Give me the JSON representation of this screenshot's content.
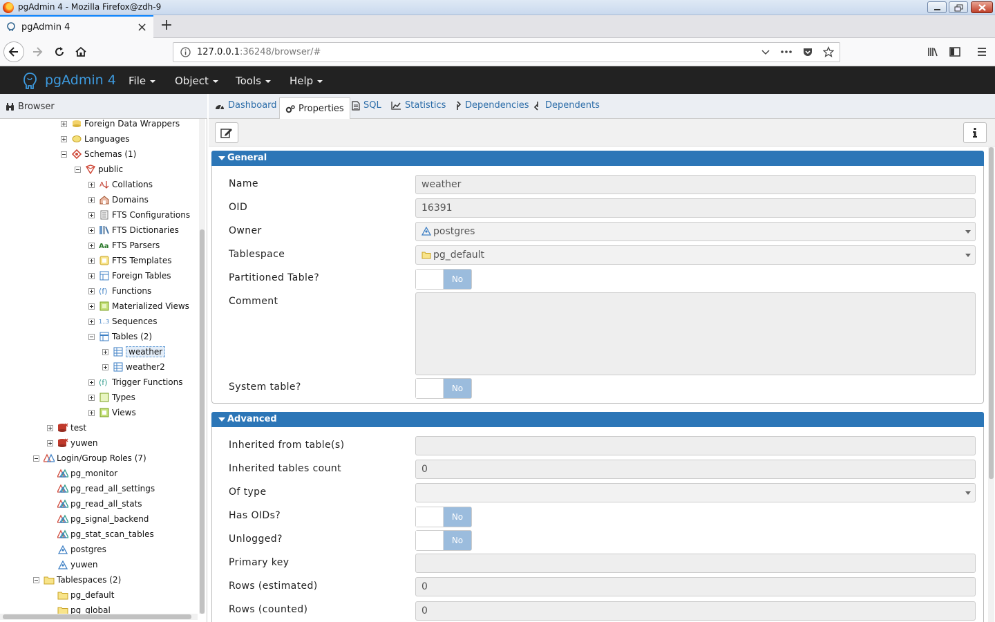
{
  "window": {
    "title": "pgAdmin 4 - Mozilla Firefox@zdh-9"
  },
  "browser_tab": {
    "label": "pgAdmin 4",
    "close": "×",
    "new_tab": "+"
  },
  "address": {
    "host": "127.0.0.1",
    "rest": ":36248/browser/#"
  },
  "app": {
    "brand": "pgAdmin 4",
    "menus": [
      "File",
      "Object",
      "Tools",
      "Help"
    ]
  },
  "browser_panel": {
    "title": "Browser",
    "tree": [
      {
        "label": "Foreign Data Wrappers",
        "depth": 4,
        "expander": "plus",
        "icon": "fdw-icon"
      },
      {
        "label": "Languages",
        "depth": 4,
        "expander": "plus",
        "icon": "language-icon"
      },
      {
        "label": "Schemas (1)",
        "depth": 4,
        "expander": "minus",
        "icon": "schemas-icon"
      },
      {
        "label": "public",
        "depth": 5,
        "expander": "minus",
        "icon": "schema-icon"
      },
      {
        "label": "Collations",
        "depth": 6,
        "expander": "plus",
        "icon": "collation-icon"
      },
      {
        "label": "Domains",
        "depth": 6,
        "expander": "plus",
        "icon": "domain-icon"
      },
      {
        "label": "FTS Configurations",
        "depth": 6,
        "expander": "plus",
        "icon": "fts-config-icon"
      },
      {
        "label": "FTS Dictionaries",
        "depth": 6,
        "expander": "plus",
        "icon": "fts-dict-icon"
      },
      {
        "label": "FTS Parsers",
        "depth": 6,
        "expander": "plus",
        "icon": "fts-parser-icon"
      },
      {
        "label": "FTS Templates",
        "depth": 6,
        "expander": "plus",
        "icon": "fts-template-icon"
      },
      {
        "label": "Foreign Tables",
        "depth": 6,
        "expander": "plus",
        "icon": "foreign-table-icon"
      },
      {
        "label": "Functions",
        "depth": 6,
        "expander": "plus",
        "icon": "function-icon"
      },
      {
        "label": "Materialized Views",
        "depth": 6,
        "expander": "plus",
        "icon": "mview-icon"
      },
      {
        "label": "Sequences",
        "depth": 6,
        "expander": "plus",
        "icon": "sequence-icon"
      },
      {
        "label": "Tables (2)",
        "depth": 6,
        "expander": "minus",
        "icon": "tables-icon"
      },
      {
        "label": "weather",
        "depth": 7,
        "expander": "plus",
        "icon": "table-icon",
        "selected": true
      },
      {
        "label": "weather2",
        "depth": 7,
        "expander": "plus",
        "icon": "table-icon"
      },
      {
        "label": "Trigger Functions",
        "depth": 6,
        "expander": "plus",
        "icon": "trigger-function-icon"
      },
      {
        "label": "Types",
        "depth": 6,
        "expander": "plus",
        "icon": "type-icon"
      },
      {
        "label": "Views",
        "depth": 6,
        "expander": "plus",
        "icon": "view-icon"
      },
      {
        "label": "test",
        "depth": 3,
        "expander": "plus",
        "icon": "database-icon"
      },
      {
        "label": "yuwen",
        "depth": 3,
        "expander": "plus",
        "icon": "database-icon"
      },
      {
        "label": "Login/Group Roles (7)",
        "depth": 2,
        "expander": "minus",
        "icon": "roles-icon"
      },
      {
        "label": "pg_monitor",
        "depth": 3,
        "expander": "",
        "icon": "group-role-icon"
      },
      {
        "label": "pg_read_all_settings",
        "depth": 3,
        "expander": "",
        "icon": "group-role-icon"
      },
      {
        "label": "pg_read_all_stats",
        "depth": 3,
        "expander": "",
        "icon": "group-role-icon"
      },
      {
        "label": "pg_signal_backend",
        "depth": 3,
        "expander": "",
        "icon": "group-role-icon"
      },
      {
        "label": "pg_stat_scan_tables",
        "depth": 3,
        "expander": "",
        "icon": "group-role-icon"
      },
      {
        "label": "postgres",
        "depth": 3,
        "expander": "",
        "icon": "login-role-icon"
      },
      {
        "label": "yuwen",
        "depth": 3,
        "expander": "",
        "icon": "login-role-icon"
      },
      {
        "label": "Tablespaces (2)",
        "depth": 2,
        "expander": "minus",
        "icon": "tablespaces-icon"
      },
      {
        "label": "pg_default",
        "depth": 3,
        "expander": "",
        "icon": "tablespace-icon"
      },
      {
        "label": "pg_global",
        "depth": 3,
        "expander": "",
        "icon": "tablespace-icon"
      }
    ]
  },
  "tabs": {
    "dashboard": "Dashboard",
    "properties": "Properties",
    "sql": "SQL",
    "statistics": "Statistics",
    "dependencies": "Dependencies",
    "dependents": "Dependents"
  },
  "general": {
    "title": "General",
    "name_label": "Name",
    "name_value": "weather",
    "oid_label": "OID",
    "oid_value": "16391",
    "owner_label": "Owner",
    "owner_value": "postgres",
    "tablespace_label": "Tablespace",
    "tablespace_value": "pg_default",
    "partitioned_label": "Partitioned Table?",
    "partitioned_value": "No",
    "comment_label": "Comment",
    "comment_value": "",
    "system_label": "System table?",
    "system_value": "No"
  },
  "advanced": {
    "title": "Advanced",
    "inherited_from_label": "Inherited from table(s)",
    "inherited_from_value": "",
    "inherited_count_label": "Inherited tables count",
    "inherited_count_value": "0",
    "of_type_label": "Of type",
    "of_type_value": "",
    "has_oids_label": "Has OIDs?",
    "has_oids_value": "No",
    "unlogged_label": "Unlogged?",
    "unlogged_value": "No",
    "primary_key_label": "Primary key",
    "primary_key_value": "",
    "rows_est_label": "Rows (estimated)",
    "rows_est_value": "0",
    "rows_counted_label": "Rows (counted)",
    "rows_counted_value": "0"
  },
  "colors": {
    "accent": "#2c76b7",
    "header_bg": "#222222",
    "brand": "#3d9be0",
    "toggle_no": "#9bbcdd"
  }
}
